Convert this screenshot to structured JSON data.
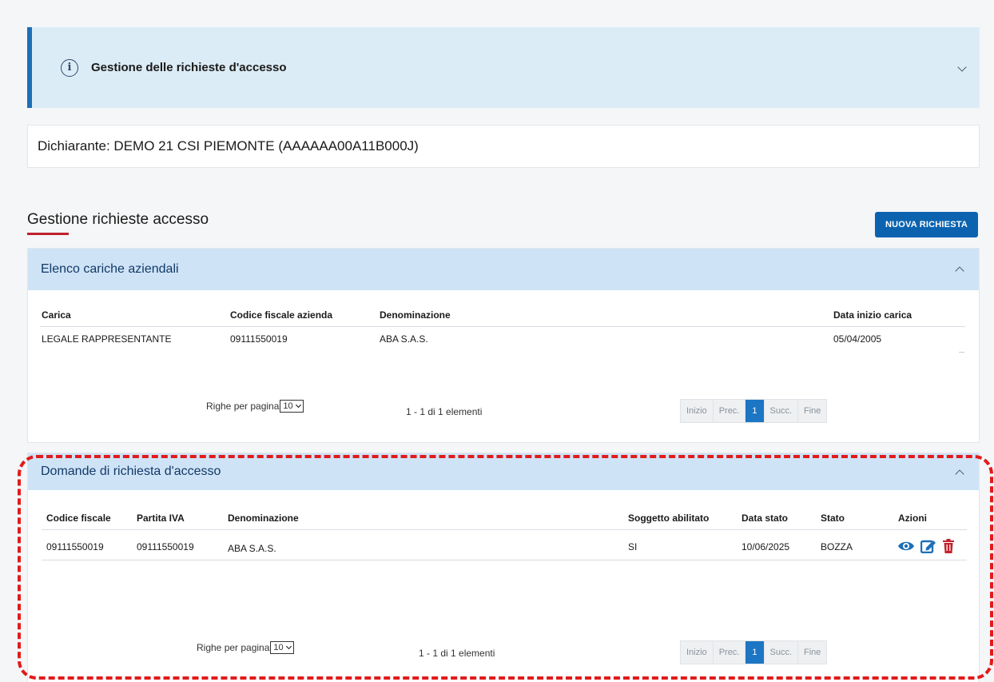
{
  "info_banner": {
    "title": "Gestione delle richieste d'accesso"
  },
  "declarant": {
    "text": "Dichiarante: DEMO 21 CSI PIEMONTE (AAAAAA00A11B000J)"
  },
  "section": {
    "title": "Gestione richieste accesso",
    "new_button": "NUOVA RICHIESTA"
  },
  "panel_cariche": {
    "title": "Elenco cariche aziendali",
    "columns": [
      "Carica",
      "Codice fiscale azienda",
      "Denominazione",
      "Data inizio carica"
    ],
    "rows": [
      [
        "LEGALE RAPPRESENTANTE",
        "09111550019",
        "ABA S.A.S.",
        "05/04/2005"
      ]
    ],
    "rows_per_page_label": "Righe per pagina",
    "rows_per_page_value": "10",
    "range_text": "1 - 1 di 1 elementi",
    "pager": {
      "first": "Inizio",
      "prev": "Prec.",
      "current": "1",
      "next": "Succ.",
      "last": "Fine"
    }
  },
  "panel_domande": {
    "title": "Domande di richiesta d'accesso",
    "columns": [
      "Codice fiscale",
      "Partita IVA",
      "Denominazione",
      "Soggetto abilitato",
      "Data stato",
      "Stato",
      "Azioni"
    ],
    "rows": [
      [
        "09111550019",
        "09111550019",
        "ABA S.A.S.",
        "SI",
        "10/06/2025",
        "BOZZA"
      ]
    ],
    "rows_per_page_label": "Righe per pagina",
    "rows_per_page_value": "10",
    "range_text": "1 - 1 di 1 elementi",
    "pager": {
      "first": "Inizio",
      "prev": "Prec.",
      "current": "1",
      "next": "Succ.",
      "last": "Fine"
    },
    "action_icons": [
      "eye-icon",
      "edit-icon",
      "trash-icon"
    ]
  },
  "colors": {
    "primary": "#0b63b0",
    "banner_bg": "#dcecf6",
    "panel_head": "#cfe3f7",
    "danger": "#c0222d",
    "highlight": "#e11b1b"
  }
}
